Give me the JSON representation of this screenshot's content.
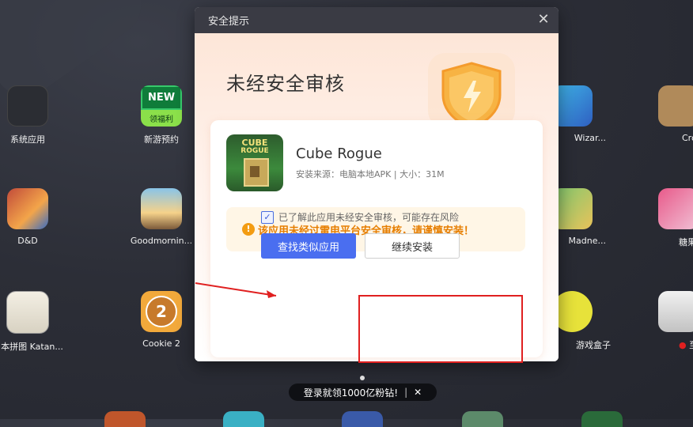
{
  "desktop": {
    "apps": [
      {
        "id": "system-apps",
        "label": "系统应用"
      },
      {
        "id": "new-games",
        "label": "新游预约",
        "badge_top": "NEW",
        "badge_bottom": "领福利"
      },
      {
        "id": "dnd",
        "label": "D&D"
      },
      {
        "id": "goodmorning",
        "label": "Goodmornin..."
      },
      {
        "id": "katana",
        "label": "日本拼图 Katan..."
      },
      {
        "id": "cookie2",
        "label": "Cookie 2"
      },
      {
        "id": "wizard",
        "label": "Wizar..."
      },
      {
        "id": "madness",
        "label": "Madne..."
      },
      {
        "id": "gamebox",
        "label": "游戏盒子"
      },
      {
        "id": "cro",
        "label": "Cro"
      },
      {
        "id": "candy",
        "label": "糖果"
      },
      {
        "id": "right-bottom",
        "label": "至"
      }
    ]
  },
  "dialog": {
    "title": "安全提示",
    "heading": "未经安全审核",
    "app_name": "Cube Rogue",
    "app_meta": "安装来源：电脑本地APK | 大小：31M",
    "warning_text": "该应用未经过雷电平台安全审核，请谨慎安装！",
    "checkbox_label": "已了解此应用未经安全审核，可能存在风险",
    "checkbox_checked": true,
    "find_similar_label": "查找类似应用",
    "continue_label": "继续安装",
    "icon_text_top": "CUBE",
    "icon_text_bottom": "ROGUE"
  },
  "toast": {
    "text": "登录就领1000亿粉钻!",
    "separator": "|",
    "close": "✕"
  },
  "colors": {
    "primary": "#4a6ef0",
    "warning": "#e67e00",
    "annotation": "#e02020"
  }
}
